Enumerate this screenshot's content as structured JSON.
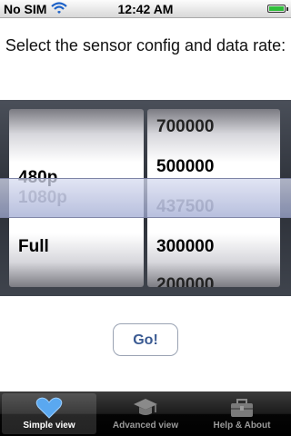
{
  "status_bar": {
    "carrier": "No SIM",
    "time": "12:42 AM",
    "wifi_icon": "wifi-icon",
    "battery_icon": "battery-icon",
    "battery_level": 1.0
  },
  "prompt": "Select the sensor config and data rate:",
  "picker": {
    "config_options": [
      "480p",
      "1080p",
      "Full"
    ],
    "config_selected": "1080p",
    "rate_options": [
      "700000",
      "500000",
      "437500",
      "300000",
      "200000"
    ],
    "rate_selected": "437500"
  },
  "go_button": "Go!",
  "tab_bar": {
    "tabs": [
      {
        "label": "Simple view",
        "icon": "heart-icon",
        "selected": true
      },
      {
        "label": "Advanced view",
        "icon": "graduation-cap-icon",
        "selected": false
      },
      {
        "label": "Help & About",
        "icon": "toolbox-icon",
        "selected": false
      }
    ]
  },
  "colors": {
    "button_text": "#3a5a92",
    "heart": "#5aa8f0",
    "picker_frame": "#2b2f37"
  }
}
